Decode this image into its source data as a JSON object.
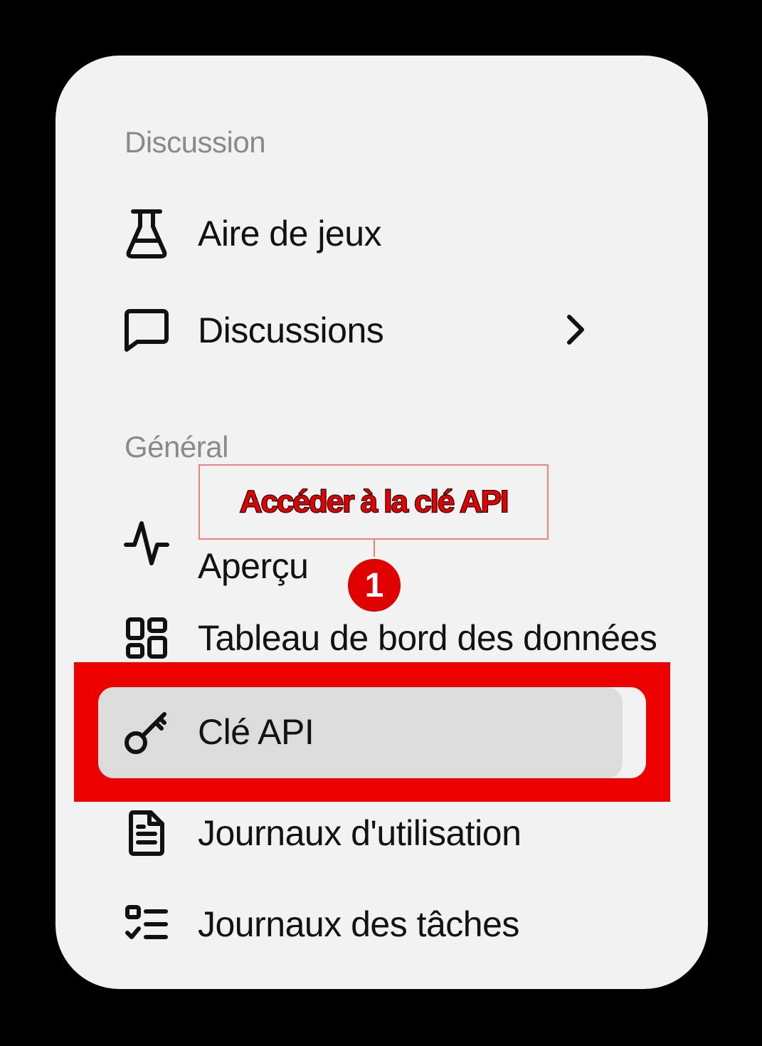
{
  "sections": {
    "discussion_label": "Discussion",
    "general_label": "Général"
  },
  "items": {
    "playground": {
      "label": "Aire de jeux",
      "icon": "flask-icon"
    },
    "discussions": {
      "label": "Discussions",
      "icon": "chat-bubble-icon",
      "trailing_icon": "chevron-right-icon"
    },
    "overview": {
      "label": "Aperçu",
      "icon": "activity-icon"
    },
    "data_dashboard": {
      "label": "Tableau de bord des données",
      "icon": "grid-icon"
    },
    "api_key": {
      "label": "Clé API",
      "icon": "key-icon",
      "selected": true
    },
    "usage_logs": {
      "label": "Journaux d'utilisation",
      "icon": "document-icon"
    },
    "task_logs": {
      "label": "Journaux des tâches",
      "icon": "checklist-icon"
    }
  },
  "annotation": {
    "callout_text": "Accéder à la clé API",
    "step_number": "1",
    "highlight_color": "#ee0000"
  }
}
